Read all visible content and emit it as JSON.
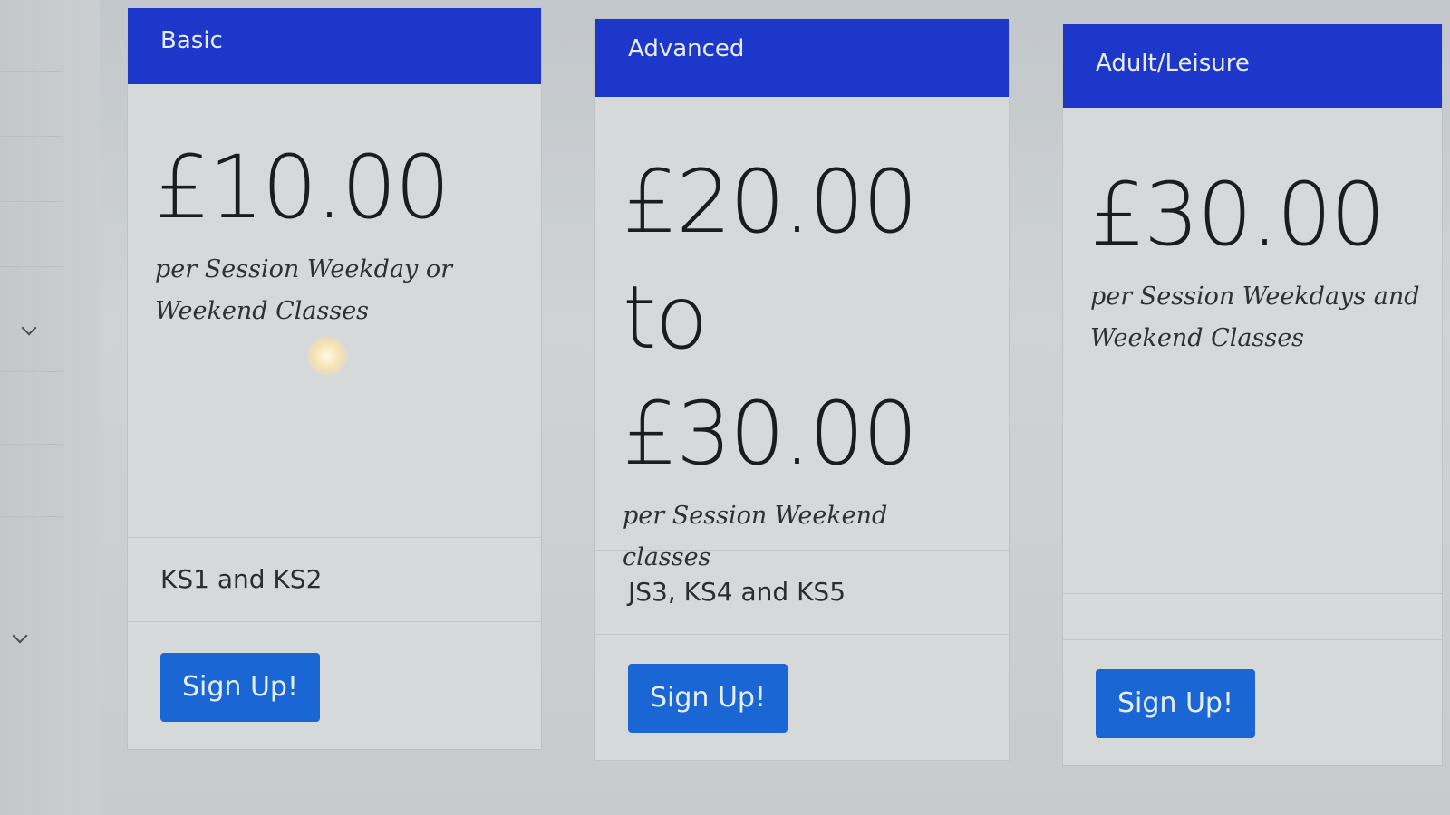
{
  "plans": [
    {
      "title": "Basic",
      "price_lines": [
        "£10.00"
      ],
      "description": "per Session Weekday or Weekend Classes",
      "feature": "KS1 and KS2",
      "button": "Sign Up!"
    },
    {
      "title": "Advanced",
      "price_lines": [
        "£20.00",
        "to",
        "£30.00"
      ],
      "description": "per Session Weekend classes",
      "feature": "JS3, KS4 and KS5",
      "button": "Sign Up!"
    },
    {
      "title": "Adult/Leisure",
      "price_lines": [
        "£30.00"
      ],
      "description": "per Session Weekdays and Weekend Classes",
      "feature": "",
      "button": "Sign Up!"
    }
  ],
  "colors": {
    "header": "#1c37c9",
    "button": "#1a66d4"
  },
  "icons": {
    "rail_chevrons": [
      "chevron-down-icon",
      "chevron-down-icon"
    ]
  }
}
